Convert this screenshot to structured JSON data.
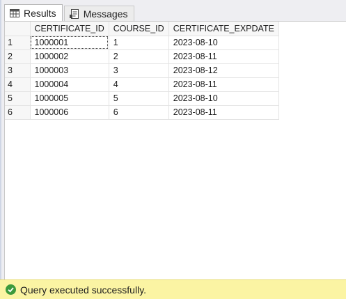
{
  "tabs": [
    {
      "label": "Results",
      "icon": "grid-icon",
      "active": true
    },
    {
      "label": "Messages",
      "icon": "messages-icon",
      "active": false
    }
  ],
  "grid": {
    "columns": [
      "CERTIFICATE_ID",
      "COURSE_ID",
      "CERTIFICATE_EXPDATE"
    ],
    "rows": [
      {
        "num": "1",
        "cells": [
          "1000001",
          "1",
          "2023-08-10"
        ]
      },
      {
        "num": "2",
        "cells": [
          "1000002",
          "2",
          "2023-08-11"
        ]
      },
      {
        "num": "3",
        "cells": [
          "1000003",
          "3",
          "2023-08-12"
        ]
      },
      {
        "num": "4",
        "cells": [
          "1000004",
          "4",
          "2023-08-11"
        ]
      },
      {
        "num": "5",
        "cells": [
          "1000005",
          "5",
          "2023-08-10"
        ]
      },
      {
        "num": "6",
        "cells": [
          "1000006",
          "6",
          "2023-08-11"
        ]
      }
    ]
  },
  "status": {
    "text": "Query executed successfully.",
    "icon": "check-circle-icon",
    "color": "#fbf4a3"
  }
}
